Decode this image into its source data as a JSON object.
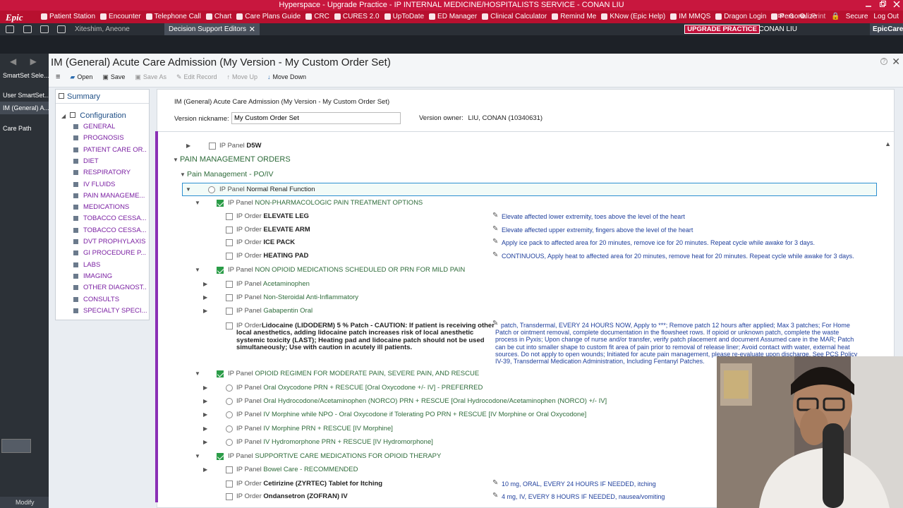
{
  "window_title": "Hyperspace - Upgrade Practice - IP INTERNAL MEDICINE/HOSPITALISTS  SERVICE - CONAN LIU",
  "toolbar": {
    "logo": "Epic",
    "items": [
      "Patient Station",
      "Encounter",
      "Telephone Call",
      "Chart",
      "Care Plans Guide",
      "CRC",
      "CURES 2.0",
      "UpToDate",
      "ED Manager",
      "Clinical Calculator",
      "Remind Me",
      "KNow (Epic Help)",
      "IM MMQS",
      "Dragon Login",
      "Personalize"
    ],
    "right": [
      "0",
      "Print",
      "Secure",
      "Log Out"
    ]
  },
  "tabs": {
    "tab1": "Xiteshim, Aneone",
    "tab2": "Decision Support Editors",
    "upgrade": "UPGRADE PRACTICE",
    "user": "CONAN LIU",
    "epiccare": "EpicCare"
  },
  "leftbar": {
    "items": [
      "SmartSet Sele...",
      "User SmartSet...",
      "IM (General) A...",
      "Care Path"
    ],
    "modify": "Modify"
  },
  "main": {
    "title": "IM (General) Acute Care Admission (My Version - My Custom Order Set)",
    "actions": {
      "open": "Open",
      "save": "Save",
      "save_as": "Save As",
      "edit_record": "Edit Record",
      "move_up": "Move Up",
      "move_down": "Move Down"
    },
    "help": "?"
  },
  "nav": {
    "summary": "Summary",
    "configuration": "Configuration",
    "sections": [
      "GENERAL",
      "PROGNOSIS",
      "PATIENT CARE OR...",
      "DIET",
      "RESPIRATORY",
      "IV FLUIDS",
      "PAIN MANAGEME...",
      "MEDICATIONS",
      "TOBACCO CESSA...",
      "TOBACCO CESSA...",
      "DVT PROPHYLAXIS",
      "GI PROCEDURE P...",
      "LABS",
      "IMAGING",
      "OTHER DIAGNOST...",
      "CONSULTS",
      "SPECIALTY SPECI..."
    ]
  },
  "content": {
    "name": "IM (General) Acute Care Admission (My Version - My Custom Order Set)",
    "version_label": "Version nickname:",
    "version_value": "My Custom Order Set",
    "owner_label": "Version owner:",
    "owner_value": "LIU, CONAN (10340631)"
  },
  "tree": {
    "d5w": {
      "prefix": "IP Panel",
      "name": "D5W"
    },
    "section": "PAIN MANAGEMENT ORDERS",
    "subsection": "Pain Management - PO/IV",
    "renal": {
      "prefix": "IP Panel",
      "name": "Normal Renal Function"
    },
    "nonpharm": {
      "prefix": "IP Panel",
      "name": "NON-PHARMACOLOGIC PAIN TREATMENT OPTIONS"
    },
    "elevate_leg": {
      "prefix": "IP Order",
      "name": "ELEVATE LEG",
      "sig": "Elevate affected lower extremity, toes above the level of the heart"
    },
    "elevate_arm": {
      "prefix": "IP Order",
      "name": "ELEVATE ARM",
      "sig": "Elevate affected upper extremity, fingers above the level of the heart"
    },
    "ice_pack": {
      "prefix": "IP Order",
      "name": "ICE PACK",
      "sig": "Apply ice pack to affected area for 20 minutes, remove ice for 20 minutes. Repeat cycle while awake for 3 days."
    },
    "heating_pad": {
      "prefix": "IP Order",
      "name": "HEATING PAD",
      "sig": "CONTINUOUS, Apply heat to affected area for 20 minutes, remove heat for 20 minutes. Repeat cycle while awake for 3 days."
    },
    "nonopioid": {
      "prefix": "IP Panel",
      "name": "NON OPIOID MEDICATIONS SCHEDULED OR PRN FOR MILD PAIN"
    },
    "acetaminophen": {
      "prefix": "IP Panel",
      "name": "Acetaminophen"
    },
    "nsaid": {
      "prefix": "IP Panel",
      "name": "Non-Steroidal Anti-Inflammatory"
    },
    "gabapentin": {
      "prefix": "IP Panel",
      "name": "Gabapentin Oral"
    },
    "lidocaine": {
      "prefix": "IP Order",
      "name_lines": [
        "Lidocaine (LIDODERM) 5 % Patch - CAUTION: If patient is receiving other",
        "local anesthetics, adding lidocaine patch increases risk of local anesthetic",
        "systemic toxicity (LAST); Heating pad and lidocaine patch should not be used",
        "simultaneously; Use with caution in acutely ill patients."
      ],
      "sig_lines": [
        "patch, Transdermal, EVERY 24 HOURS NOW, Apply to ***; Remove patch 12 hours after applied; Max 3 patches; For Home",
        "Patch or ointment removal, complete documentation in the flowsheet rows. If opioid or unknown patch, complete the waste",
        "process in Pyxis; Upon change of nurse and/or transfer, verify patch placement and document Assumed care in the MAR; Patch",
        "can be cut into smaller shape to custom fit area of pain prior to removal of release liner; Avoid contact with water, external heat",
        "sources. Do not apply to open wounds; Initiated for acute pain management, please re-evaluate upon discharge. See PCS Policy",
        "IV-39, Transdermal Medication Administration, Including Fentanyl Patches."
      ]
    },
    "opioid": {
      "prefix": "IP Panel",
      "name": "OPIOID REGIMEN FOR MODERATE PAIN, SEVERE PAIN, AND RESCUE"
    },
    "oxy": {
      "prefix": "IP Panel",
      "name": "Oral Oxycodone PRN + RESCUE [Oral Oxycodone +/- IV] - PREFERRED"
    },
    "norco": {
      "prefix": "IP Panel",
      "name": "Oral Hydrocodone/Acetaminophen (NORCO) PRN + RESCUE [Oral Hydrocodone/Acetaminophen (NORCO) +/- IV]"
    },
    "morph_npo": {
      "prefix": "IP Panel",
      "name": "IV Morphine while NPO - Oral Oxycodone if Tolerating PO PRN + RESCUE [IV Morphine or Oral Oxycodone]"
    },
    "morph_prn": {
      "prefix": "IP Panel",
      "name": "IV Morphine PRN + RESCUE [IV Morphine]"
    },
    "hydromorph": {
      "prefix": "IP Panel",
      "name": "IV Hydromorphone PRN + RESCUE [IV Hydromorphone]"
    },
    "supportive": {
      "prefix": "IP Panel",
      "name": "SUPPORTIVE CARE MEDICATIONS FOR OPIOID THERAPY"
    },
    "bowel": {
      "prefix": "IP Panel",
      "name": "Bowel Care - RECOMMENDED"
    },
    "cetirizine": {
      "prefix": "IP Order",
      "name": "Cetirizine (ZYRTEC) Tablet for Itching",
      "sig": "10 mg, ORAL, EVERY 24 HOURS IF NEEDED, itching"
    },
    "ondansetron": {
      "prefix": "IP Order",
      "name": "Ondansetron (ZOFRAN) IV",
      "sig": "4 mg, IV, EVERY 8 HOURS IF NEEDED, nausea/vomiting"
    }
  },
  "colors": {
    "epic_red": "#b8102f",
    "green_check": "#2a9c47",
    "link_purple": "#7a1fa2",
    "sig_blue": "#1f3f9c",
    "select_blue": "#2d8fd1"
  }
}
